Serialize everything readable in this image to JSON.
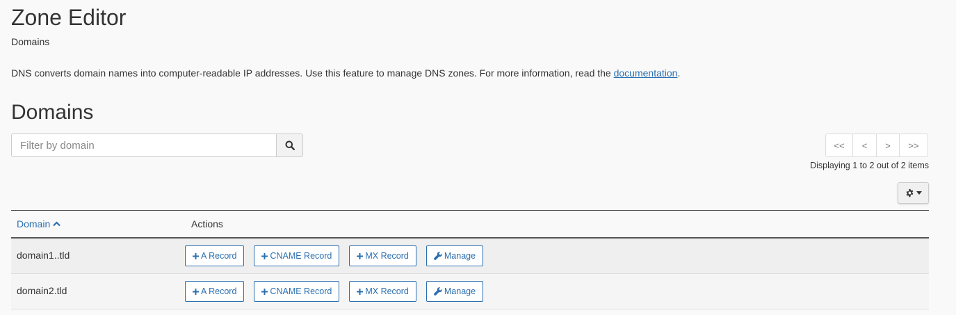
{
  "header": {
    "title": "Zone Editor",
    "subtitle": "Domains"
  },
  "description": {
    "text": "DNS converts domain names into computer-readable IP addresses. Use this feature to manage DNS zones. For more information, read the ",
    "link_label": "documentation",
    "trailing": "."
  },
  "section": {
    "title": "Domains"
  },
  "search": {
    "placeholder": "Filter by domain",
    "value": "",
    "icon": "search-icon"
  },
  "pager": {
    "first_label": "<<",
    "prev_label": "<",
    "next_label": ">",
    "last_label": ">>",
    "info": "Displaying 1 to 2 out of 2 items"
  },
  "settings": {
    "icon": "gear-icon"
  },
  "table": {
    "columns": {
      "domain": "Domain",
      "actions": "Actions"
    },
    "sort_icon": "chevron-up-icon",
    "rows": [
      {
        "domain": "domain1..tld",
        "actions": {
          "a_record": "A Record",
          "cname_record": "CNAME Record",
          "mx_record": "MX Record",
          "manage": "Manage"
        }
      },
      {
        "domain": "domain2.tld",
        "actions": {
          "a_record": "A Record",
          "cname_record": "CNAME Record",
          "mx_record": "MX Record",
          "manage": "Manage"
        }
      }
    ]
  },
  "colors": {
    "link": "#2a6fb0",
    "text": "#333333",
    "background": "#f9f9f9"
  }
}
